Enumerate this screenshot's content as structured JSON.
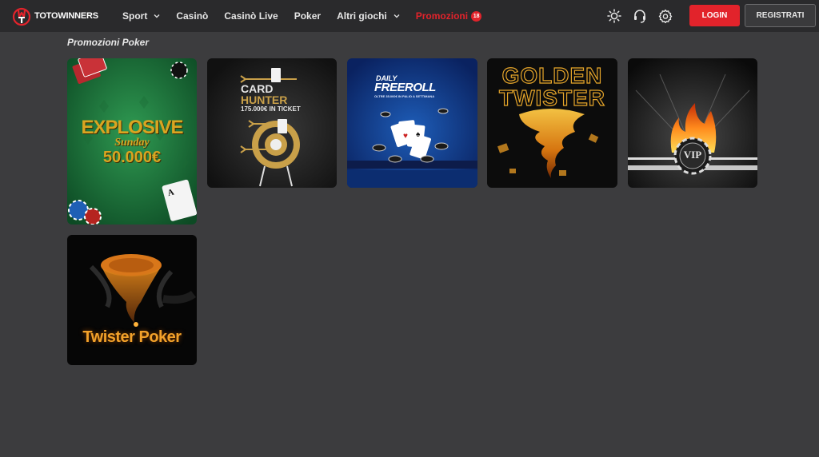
{
  "header": {
    "logo": {
      "part1": "TOTO",
      "part2": "WINNERS"
    },
    "nav": [
      {
        "label": "Sport",
        "has_dropdown": true
      },
      {
        "label": "Casinò",
        "has_dropdown": false
      },
      {
        "label": "Casinò Live",
        "has_dropdown": false
      },
      {
        "label": "Poker",
        "has_dropdown": false
      },
      {
        "label": "Altri giochi",
        "has_dropdown": true
      },
      {
        "label": "Promozioni",
        "has_dropdown": false,
        "badge": "18"
      }
    ],
    "tools": [
      "sun-icon",
      "headset-icon",
      "settings-icon"
    ],
    "login_label": "LOGIN",
    "register_label": "REGISTRATI"
  },
  "section": {
    "title": "Promozioni Poker"
  },
  "promos": [
    {
      "id": "explosive",
      "line1": "EXPLOSIVE",
      "line2": "Sunday",
      "line3": "50.000€"
    },
    {
      "id": "cardhunter",
      "line1": "CARD",
      "line2": "HUNTER",
      "line3": "175.000€ IN TICKET"
    },
    {
      "id": "freeroll",
      "line1": "DAILY",
      "line2": "FREEROLL",
      "line3": "OLTRE 35.000€ IN PALIO A SETTIMANA"
    },
    {
      "id": "golden",
      "line1": "GOLDEN",
      "line2": "TWISTER"
    },
    {
      "id": "vip",
      "line1": "VIP"
    },
    {
      "id": "twister",
      "line1": "Twister Poker"
    }
  ],
  "colors": {
    "accent": "#e2232b",
    "background": "#3c3c3e",
    "header": "#2a2a2c",
    "gold": "#d9a521"
  }
}
